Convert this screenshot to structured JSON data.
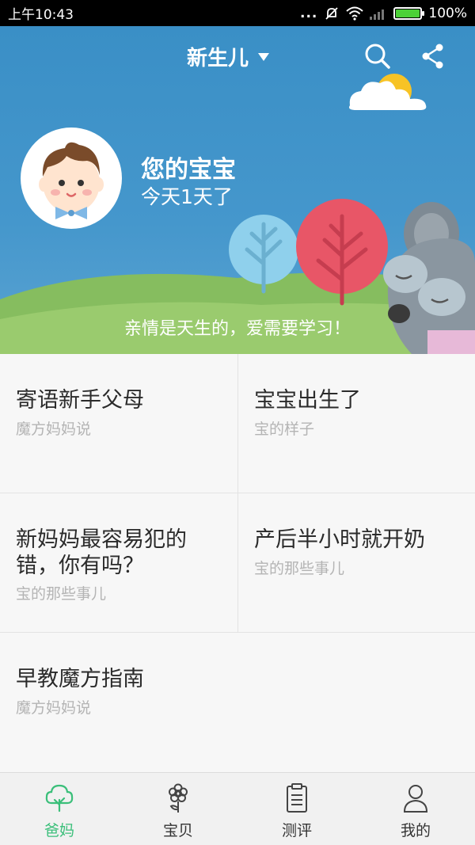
{
  "status_bar": {
    "time": "上午10:43",
    "signal_dots": "...",
    "battery_percent": "100%",
    "battery_level": 1.0
  },
  "header": {
    "title": "新生儿"
  },
  "baby": {
    "name": "您的宝宝",
    "age": "今天1天了"
  },
  "hero": {
    "slogan": "亲情是天生的，爱需要学习！"
  },
  "articles": [
    {
      "title": "寄语新手父母",
      "subtitle": "魔方妈妈说"
    },
    {
      "title": "宝宝出生了",
      "subtitle": "宝的样子"
    },
    {
      "title": "新妈妈最容易犯的错，你有吗？",
      "subtitle": "宝的那些事儿"
    },
    {
      "title": "产后半小时就开奶",
      "subtitle": "宝的那些事儿"
    },
    {
      "title": "早教魔方指南",
      "subtitle": "魔方妈妈说"
    }
  ],
  "nav": {
    "items": [
      {
        "label": "爸妈",
        "icon": "tree-icon",
        "active": true
      },
      {
        "label": "宝贝",
        "icon": "flower-icon",
        "active": false
      },
      {
        "label": "测评",
        "icon": "clipboard-icon",
        "active": false
      },
      {
        "label": "我的",
        "icon": "person-icon",
        "active": false
      }
    ]
  },
  "colors": {
    "accent": "#3bbf7a",
    "sky": "#3a8fc6",
    "grass": "#8cc063"
  }
}
